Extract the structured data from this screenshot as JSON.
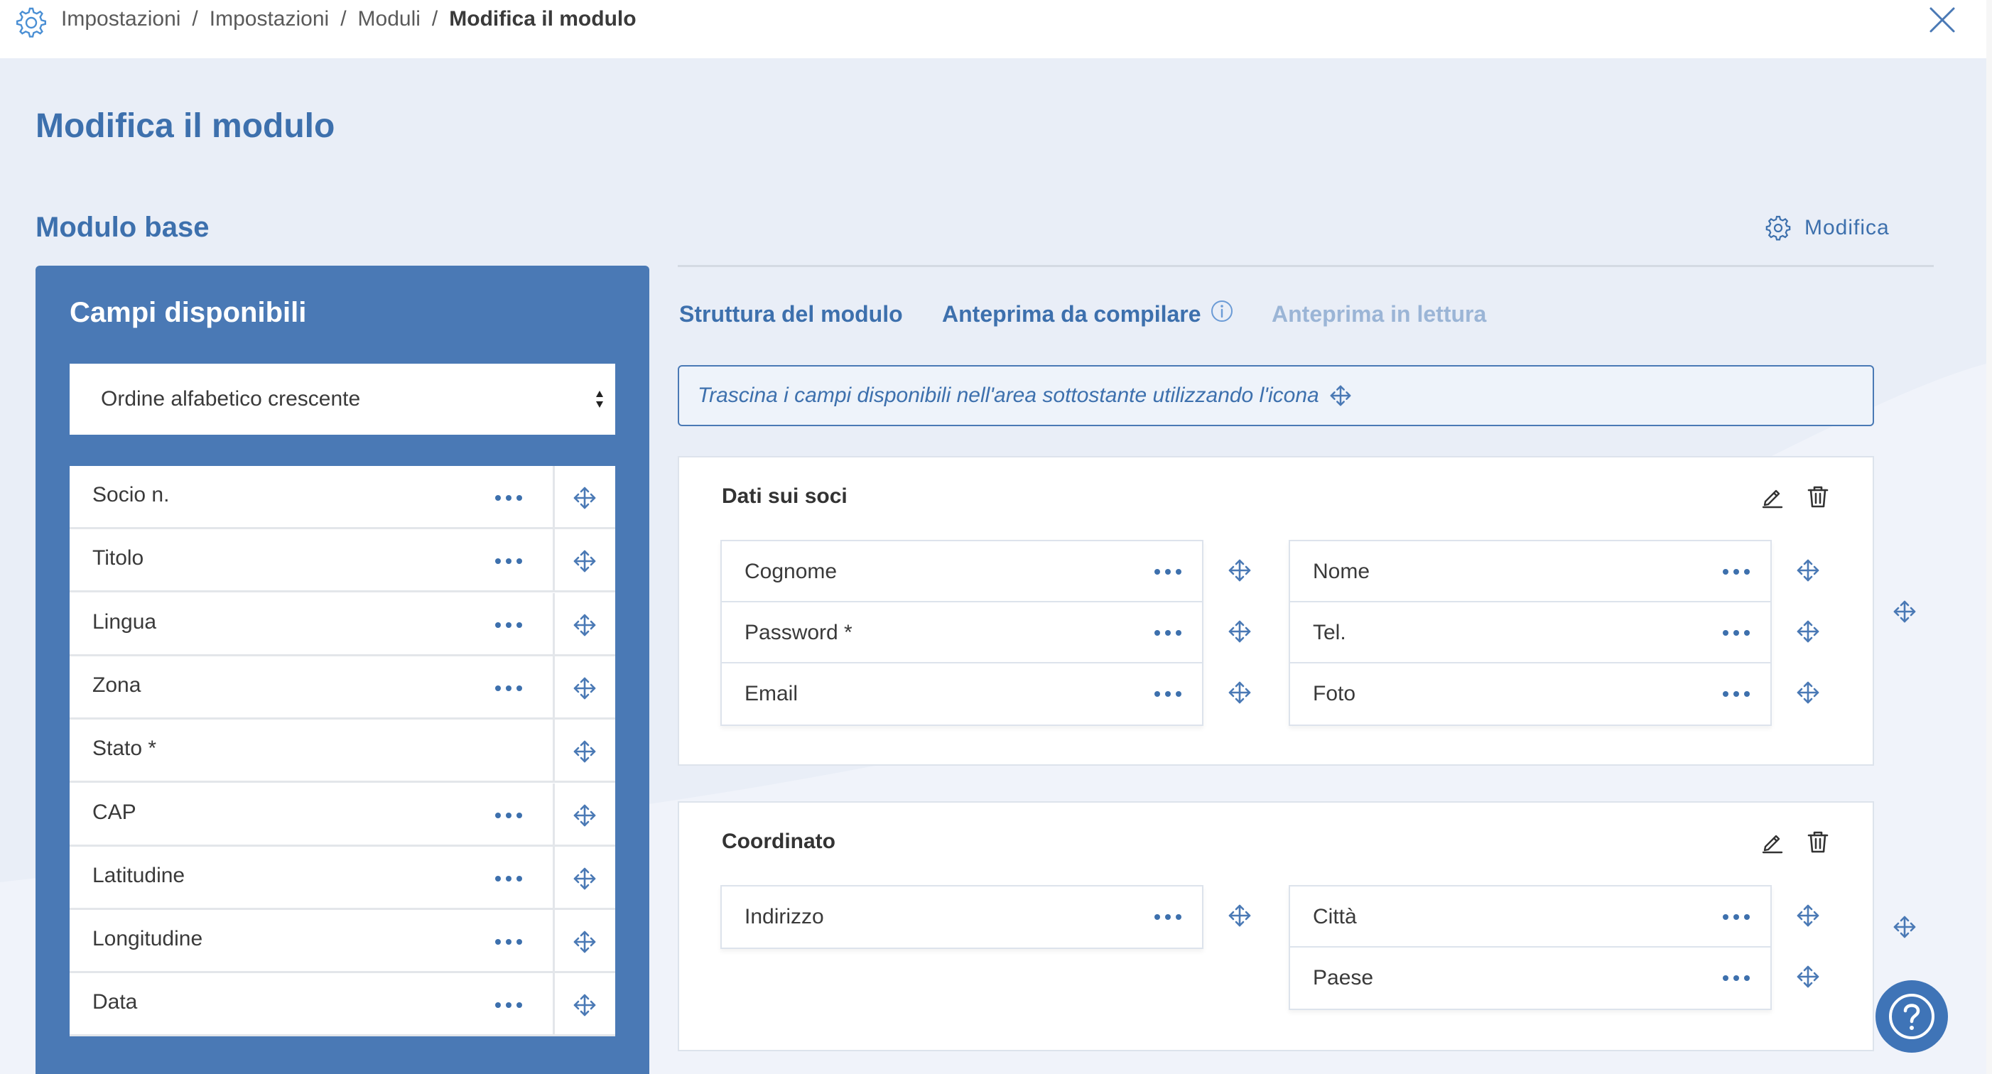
{
  "breadcrumb": {
    "items": [
      "Impostazioni",
      "Impostazioni",
      "Moduli"
    ],
    "current": "Modifica il modulo",
    "separator": "/"
  },
  "page": {
    "title": "Modifica il modulo",
    "section_title": "Modulo base",
    "edit_label": "Modifica"
  },
  "available_fields": {
    "title": "Campi disponibili",
    "sort_value": "Ordine alfabetico crescente",
    "items": [
      {
        "label": "Socio n.",
        "has_menu": true
      },
      {
        "label": "Titolo",
        "has_menu": true
      },
      {
        "label": "Lingua",
        "has_menu": true
      },
      {
        "label": "Zona",
        "has_menu": true
      },
      {
        "label": "Stato *",
        "has_menu": false
      },
      {
        "label": "CAP",
        "has_menu": true
      },
      {
        "label": "Latitudine",
        "has_menu": true
      },
      {
        "label": "Longitudine",
        "has_menu": true
      },
      {
        "label": "Data",
        "has_menu": true
      }
    ]
  },
  "tabs": [
    {
      "label": "Struttura del modulo",
      "state": "active"
    },
    {
      "label": "Anteprima da compilare",
      "state": "active"
    },
    {
      "label": "Anteprima in lettura",
      "state": "inactive"
    }
  ],
  "hint": "Trascina i campi disponibili nell'area sottostante utilizzando l'icona",
  "sections": [
    {
      "title": "Dati sui soci",
      "left_fields": [
        "Cognome",
        "Password *",
        "Email"
      ],
      "right_fields": [
        "Nome",
        "Tel.",
        "Foto"
      ]
    },
    {
      "title": "Coordinato",
      "left_fields": [
        "Indirizzo"
      ],
      "right_fields": [
        "Città",
        "Paese"
      ]
    }
  ],
  "colors": {
    "primary": "#3d70ad",
    "panel": "#4a79b5",
    "background": "#e9eef7",
    "inactive_tab": "#9bb5d6",
    "icon": "#4a79b5"
  },
  "icons": [
    "gear-icon",
    "close-icon",
    "more-dots-icon",
    "move-icon",
    "edit-icon",
    "trash-icon",
    "info-icon",
    "help-icon",
    "sort-arrows-icon"
  ]
}
